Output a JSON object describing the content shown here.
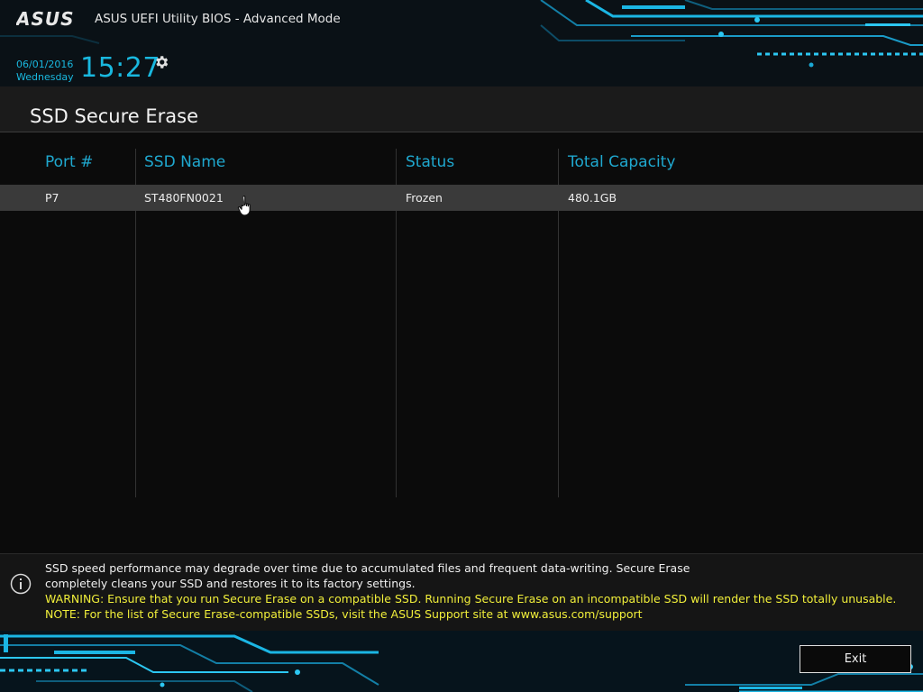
{
  "header": {
    "brand": "ASUS",
    "title": "ASUS UEFI Utility BIOS - Advanced Mode",
    "date": "06/01/2016",
    "weekday": "Wednesday",
    "time": "15:27",
    "settings_icon": "gear-icon"
  },
  "page": {
    "title": "SSD Secure Erase"
  },
  "table": {
    "columns": [
      "Port #",
      "SSD Name",
      "Status",
      "Total Capacity"
    ],
    "rows": [
      {
        "port": "P7",
        "name": "ST480FN0021",
        "status": "Frozen",
        "capacity": "480.1GB"
      }
    ]
  },
  "info": {
    "icon": "info-icon",
    "description_line1": "SSD speed performance may degrade over time due to accumulated files and frequent data-writing. Secure Erase",
    "description_line2": "completely cleans your SSD and restores it to its factory settings.",
    "warning": "WARNING: Ensure that you run Secure Erase on a compatible SSD. Running Secure Erase on an incompatible SSD will render the SSD totally unusable.",
    "note": "NOTE: For the list of Secure Erase-compatible SSDs, visit the ASUS Support site at www.asus.com/support"
  },
  "footer": {
    "exit_label": "Exit"
  },
  "colors": {
    "accent": "#1fa8cf",
    "warning": "#f1ef3a",
    "selected_row": "#3a3a3a"
  }
}
